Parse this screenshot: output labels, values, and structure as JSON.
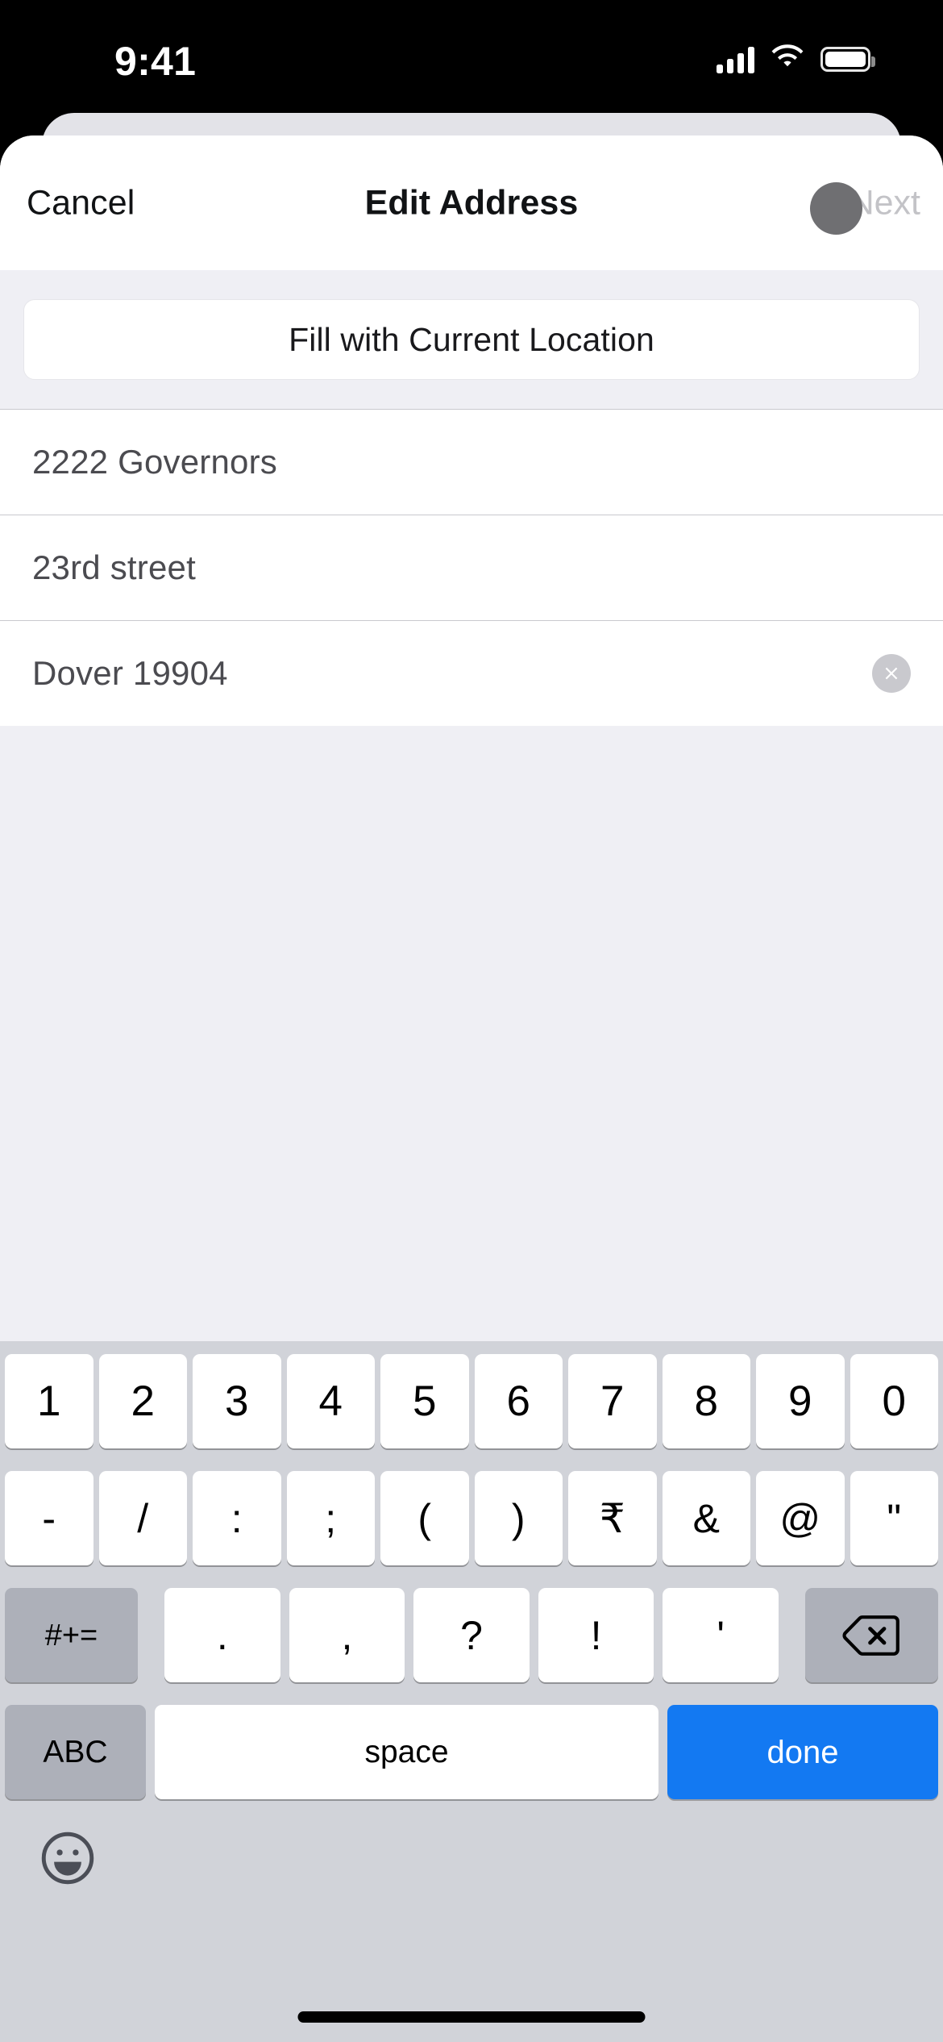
{
  "status_bar": {
    "time": "9:41",
    "cellular_icon": "cellular-signal-icon",
    "wifi_icon": "wifi-icon",
    "battery_icon": "battery-icon"
  },
  "nav_bar": {
    "cancel_label": "Cancel",
    "title": "Edit Address",
    "next_label": "Next",
    "next_disabled": true
  },
  "content": {
    "fill_location_label": "Fill with Current Location",
    "fields": [
      {
        "value": "2222 Governors",
        "has_clear": false
      },
      {
        "value": "23rd street",
        "has_clear": false
      },
      {
        "value": "Dover 19904",
        "has_clear": true
      }
    ]
  },
  "keyboard": {
    "type": "numeric-symbols",
    "row1": [
      "1",
      "2",
      "3",
      "4",
      "5",
      "6",
      "7",
      "8",
      "9",
      "0"
    ],
    "row2": [
      "-",
      "/",
      ":",
      ";",
      "(",
      ")",
      "₹",
      "&",
      "@",
      "\""
    ],
    "row3_symbols_label": "#+=",
    "row3": [
      ".",
      ",",
      "?",
      "!",
      "'"
    ],
    "row3_backspace_icon": "backspace-icon",
    "abc_label": "ABC",
    "space_label": "space",
    "done_label": "done",
    "emoji_icon": "emoji-smiley-icon"
  },
  "colors": {
    "accent_blue": "#1379f2",
    "keyboard_bg": "#d1d3d9",
    "key_white": "#ffffff",
    "key_dark": "#adb0b9",
    "table_bg": "#efeff4",
    "text_primary": "#111315",
    "text_field": "#4b4b50",
    "disabled_text": "#c3c3c7",
    "clear_button": "#c9c9ce",
    "touch_cursor": "#6f6f72"
  }
}
